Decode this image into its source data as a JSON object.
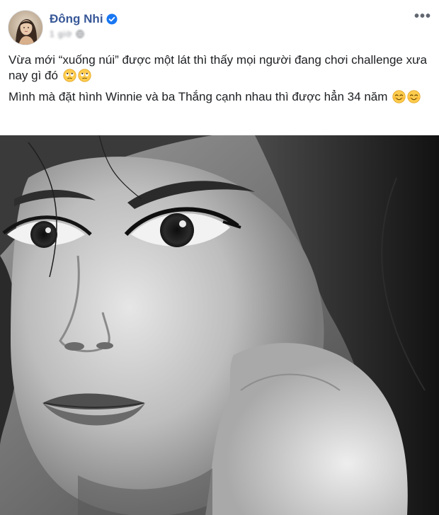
{
  "post": {
    "author": {
      "name": "Đông Nhi",
      "verified": true,
      "avatar_icon": "profile-avatar",
      "verified_icon": "verified-badge-icon"
    },
    "timestamp": "1 giờ",
    "privacy_icon": "globe-icon",
    "more_icon": "more-options-icon",
    "more_label": "•••",
    "text": {
      "line1": "Vừa mới “xuống núi” được một lát thì thấy mọi người đang chơi challenge xưa nay gì đó",
      "line1_emojis": [
        "rolling-eyes-emoji",
        "rolling-eyes-emoji"
      ],
      "line2": "Mình mà đặt hình Winnie và ba Thắng cạnh nhau thì được hẳn 34 năm",
      "line2_emojis": [
        "smiling-blush-emoji",
        "smiling-blush-emoji"
      ]
    },
    "photo": {
      "kind": "black-and-white close-up portrait"
    },
    "colors": {
      "author_link": "#385898",
      "verified_badge": "#1877f2",
      "text": "#1c1e21",
      "meta": "#8a8d91"
    }
  }
}
